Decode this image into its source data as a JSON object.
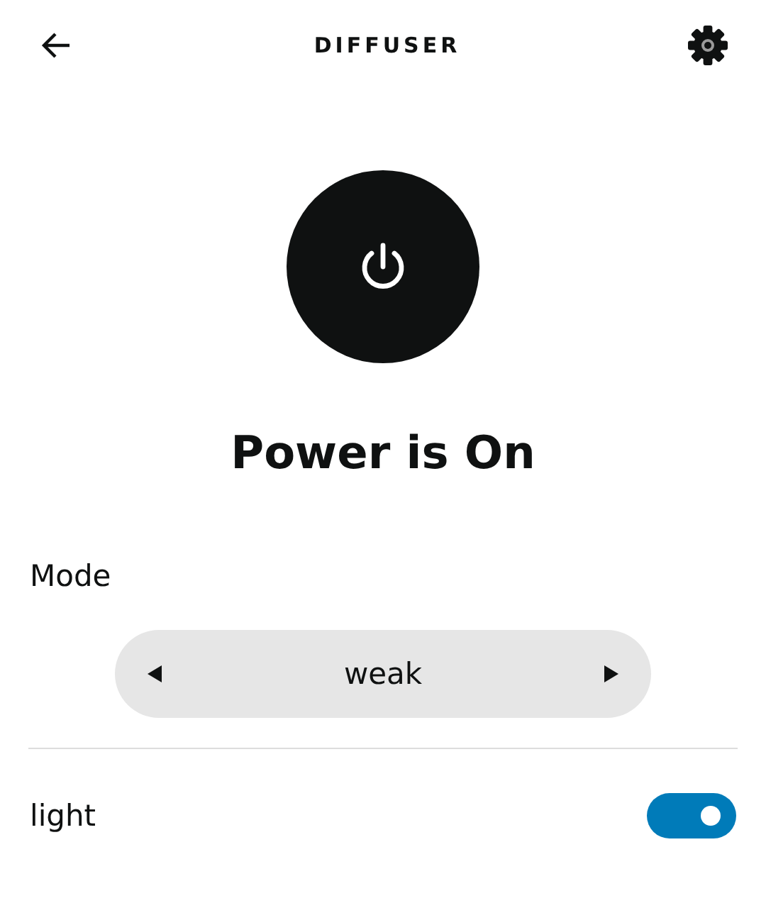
{
  "header": {
    "title": "DIFFUSER"
  },
  "power": {
    "on": true,
    "status": "Power is On"
  },
  "mode": {
    "label": "Mode",
    "value": "weak"
  },
  "toggles": [
    {
      "label": "light",
      "on": true
    }
  ]
}
